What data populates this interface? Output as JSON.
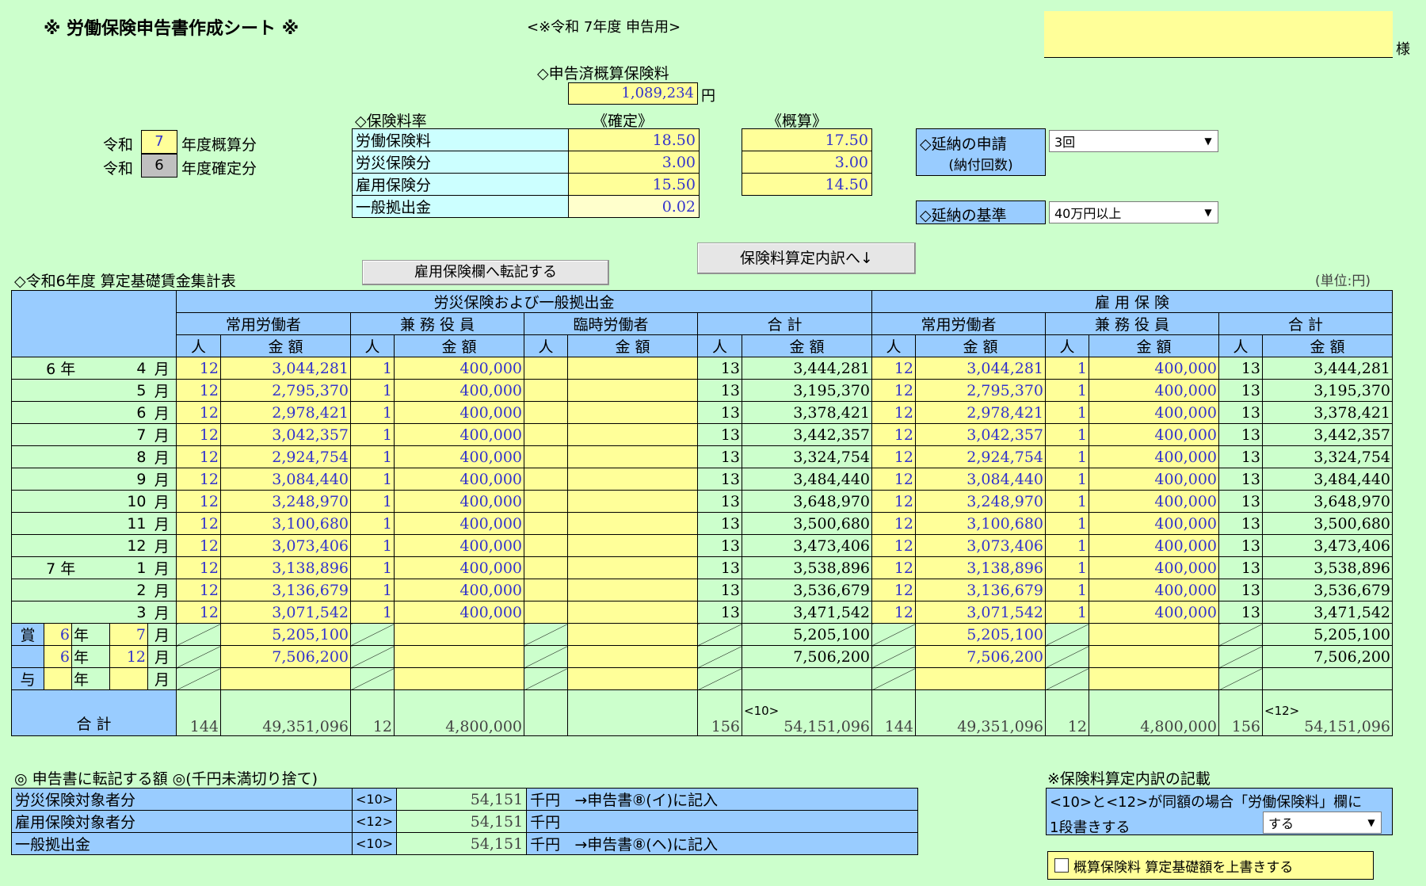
{
  "header": {
    "title": "※ 労働保険申告書作成シート ※",
    "subtitle": "<※令和 7年度 申告用>",
    "sama": "様",
    "shinkokuzumi_label": "◇申告済概算保険料",
    "shinkokuzumi_value": "1,089,234",
    "yen": "円"
  },
  "years": {
    "reiwa": "令和",
    "gaisan_year": "7",
    "gaisan_label": "年度概算分",
    "kakutei_year": "6",
    "kakutei_label": "年度確定分"
  },
  "rates": {
    "heading": "◇保険料率",
    "kakutei_head": "《確定》",
    "gaisan_head": "《概算》",
    "rows": [
      {
        "label": "労働保険料",
        "kakutei": "18.50",
        "gaisan": "17.50"
      },
      {
        "label": "労災保険分",
        "kakutei": "3.00",
        "gaisan": "3.00"
      },
      {
        "label": "雇用保険分",
        "kakutei": "15.50",
        "gaisan": "14.50"
      },
      {
        "label": "一般拠出金",
        "kakutei": "0.02",
        "gaisan": ""
      }
    ]
  },
  "ennou": {
    "request_label": "◇延納の申請",
    "request_sub": "(納付回数)",
    "request_value": "3回",
    "basis_label": "◇延納の基準",
    "basis_value": "40万円以上"
  },
  "buttons": {
    "transfer": "雇用保険欄へ転記する",
    "breakdown": "保険料算定内訳へ↓"
  },
  "table": {
    "caption": "◇令和6年度 算定基礎賃金集計表",
    "unit": "(単位:円)",
    "group1": "労災保険および一般拠出金",
    "group2": "雇 用 保 険",
    "sub1": [
      "常用労働者",
      "兼 務 役 員",
      "臨時労働者",
      "合 計"
    ],
    "sub2": [
      "常用労働者",
      "兼 務 役 員",
      "合 計"
    ],
    "person": "人",
    "amount": "金 額",
    "year6": "6 年",
    "year7": "7 年",
    "month_suffix": "月",
    "rows": [
      {
        "m": "4",
        "a": "12",
        "b": "3,044,281",
        "c": "1",
        "d": "400,000",
        "tp": "13",
        "ta": "3,444,281"
      },
      {
        "m": "5",
        "a": "12",
        "b": "2,795,370",
        "c": "1",
        "d": "400,000",
        "tp": "13",
        "ta": "3,195,370"
      },
      {
        "m": "6",
        "a": "12",
        "b": "2,978,421",
        "c": "1",
        "d": "400,000",
        "tp": "13",
        "ta": "3,378,421"
      },
      {
        "m": "7",
        "a": "12",
        "b": "3,042,357",
        "c": "1",
        "d": "400,000",
        "tp": "13",
        "ta": "3,442,357"
      },
      {
        "m": "8",
        "a": "12",
        "b": "2,924,754",
        "c": "1",
        "d": "400,000",
        "tp": "13",
        "ta": "3,324,754"
      },
      {
        "m": "9",
        "a": "12",
        "b": "3,084,440",
        "c": "1",
        "d": "400,000",
        "tp": "13",
        "ta": "3,484,440"
      },
      {
        "m": "10",
        "a": "12",
        "b": "3,248,970",
        "c": "1",
        "d": "400,000",
        "tp": "13",
        "ta": "3,648,970"
      },
      {
        "m": "11",
        "a": "12",
        "b": "3,100,680",
        "c": "1",
        "d": "400,000",
        "tp": "13",
        "ta": "3,500,680"
      },
      {
        "m": "12",
        "a": "12",
        "b": "3,073,406",
        "c": "1",
        "d": "400,000",
        "tp": "13",
        "ta": "3,473,406"
      },
      {
        "m": "1",
        "a": "12",
        "b": "3,138,896",
        "c": "1",
        "d": "400,000",
        "tp": "13",
        "ta": "3,538,896"
      },
      {
        "m": "2",
        "a": "12",
        "b": "3,136,679",
        "c": "1",
        "d": "400,000",
        "tp": "13",
        "ta": "3,536,679"
      },
      {
        "m": "3",
        "a": "12",
        "b": "3,071,542",
        "c": "1",
        "d": "400,000",
        "tp": "13",
        "ta": "3,471,542"
      }
    ],
    "bonus_label": [
      "賞",
      "与"
    ],
    "nen": "年",
    "bonus": [
      {
        "y": "6",
        "m": "7",
        "amt": "5,205,100",
        "total": "5,205,100"
      },
      {
        "y": "6",
        "m": "12",
        "amt": "7,506,200",
        "total": "7,506,200"
      },
      {
        "y": "",
        "m": "",
        "amt": "",
        "total": ""
      }
    ],
    "total_label": "合 計",
    "total_tag1": "<10>",
    "total_tag2": "<12>",
    "totals": {
      "a": "144",
      "b": "49,351,096",
      "c": "12",
      "d": "4,800,000",
      "tp": "156",
      "ta": "54,151,096"
    }
  },
  "transfer": {
    "heading": "◎ 申告書に転記する額 ◎(千円未満切り捨て)",
    "unit": "千円",
    "rows": [
      {
        "label": "労災保険対象者分",
        "tag": "<10>",
        "value": "54,151",
        "note": "→申告書⑧(イ)に記入"
      },
      {
        "label": "雇用保険対象者分",
        "tag": "<12>",
        "value": "54,151",
        "note": ""
      },
      {
        "label": "一般拠出金",
        "tag": "<10>",
        "value": "54,151",
        "note": "→申告書⑧(ヘ)に記入"
      }
    ]
  },
  "breakdown": {
    "heading": "※保険料算定内訳の記載",
    "line1": "<10>と<12>が同額の場合「労働保険料」欄に",
    "line2": "1段書きする",
    "select_value": "する",
    "checkbox_label": "概算保険料 算定基礎額を上書きする"
  }
}
